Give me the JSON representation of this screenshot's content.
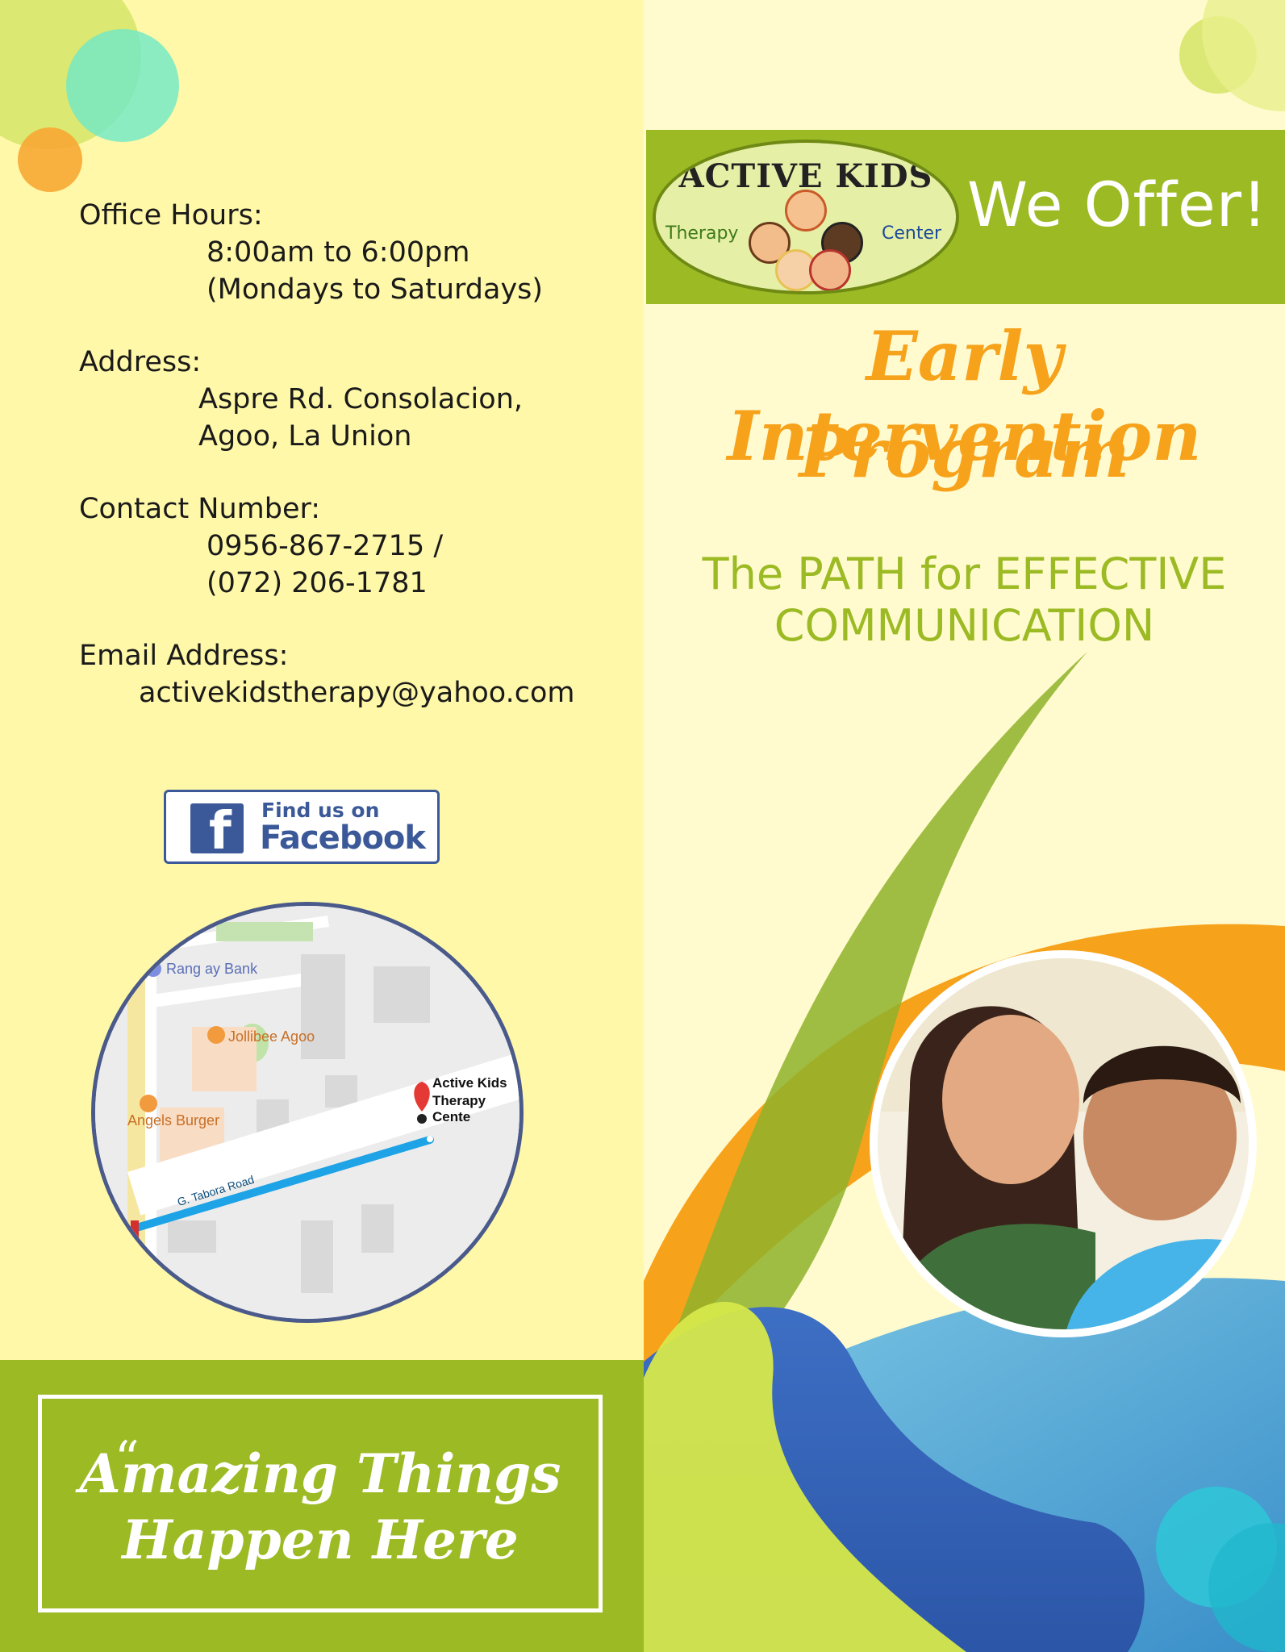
{
  "contact": {
    "office_hours_label": "Office Hours:",
    "office_hours_time": "8:00am to 6:00pm",
    "office_hours_days": "(Mondays to Saturdays)",
    "address_label": "Address:",
    "address_line1": "Aspre Rd. Consolacion,",
    "address_line2": "Agoo, La Union",
    "contact_label": "Contact Number:",
    "contact_phone1": "0956-867-2715 /",
    "contact_phone2": "(072) 206-1781",
    "email_label": "Email Address:",
    "email_value": "activekidstherapy@yahoo.com"
  },
  "facebook": {
    "find_text": "Find us on",
    "brand_text": "Facebook",
    "icon": "facebook-icon"
  },
  "map": {
    "places": [
      "Rang ay Bank",
      "Jollibee Agoo",
      "Angels Burger"
    ],
    "destination_line1": "Active Kids",
    "destination_line2": "Therapy Cente",
    "road": "G. Tabora Road"
  },
  "quote": {
    "line1": "Amazing Things",
    "line2": "Happen Here"
  },
  "header": {
    "logo_title": "ACTIVE KIDS",
    "logo_left": "Therapy",
    "logo_right": "Center",
    "we_offer": "We Offer!"
  },
  "program": {
    "title_line1": "Early Intervention",
    "title_line2": "Program",
    "subtitle_line1": "The PATH for EFFECTIVE",
    "subtitle_line2": "COMMUNICATION"
  },
  "colors": {
    "green": "#9cba24",
    "orange": "#f7a21b",
    "yellow_bg": "#fff8a8",
    "blue": "#3d6fc4",
    "facebook_blue": "#3b5998"
  }
}
